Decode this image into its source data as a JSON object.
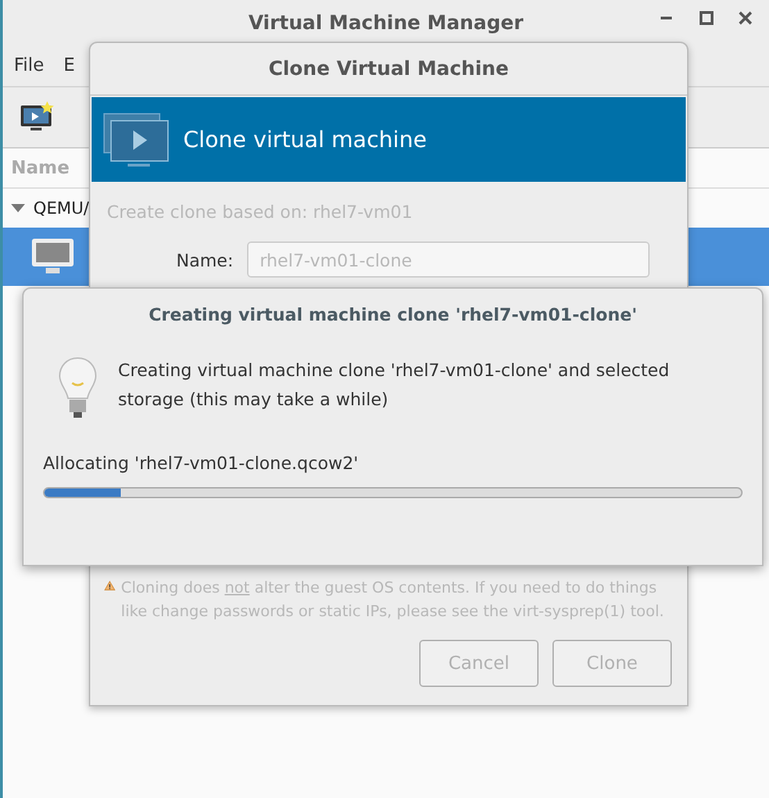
{
  "window": {
    "title": "Virtual Machine Manager"
  },
  "menu": [
    "File",
    "E"
  ],
  "list": {
    "column": "Name",
    "group": {
      "label": "QEMU/",
      "expanded": true
    },
    "row": {
      "selected": true
    }
  },
  "clone_dialog": {
    "title": "Clone Virtual Machine",
    "banner": "Clone virtual machine",
    "based_on": "Create clone based on:  rhel7-vm01",
    "name_label": "Name:",
    "name_value": "rhel7-vm01-clone",
    "disabled": true,
    "warning": {
      "before": "Cloning does ",
      "underlined": "not",
      "after": " alter the guest OS contents. If you need to do things like change passwords or static IPs, please see the virt-sysprep(1) tool."
    },
    "buttons": [
      "Cancel",
      "Clone"
    ]
  },
  "progress_dialog": {
    "title": "Creating virtual machine clone 'rhel7-vm01-clone'",
    "message": "Creating virtual machine clone 'rhel7-vm01-clone' and selected storage (this may take a while)",
    "status": "Allocating 'rhel7-vm01-clone.qcow2'",
    "level": 0.11
  }
}
